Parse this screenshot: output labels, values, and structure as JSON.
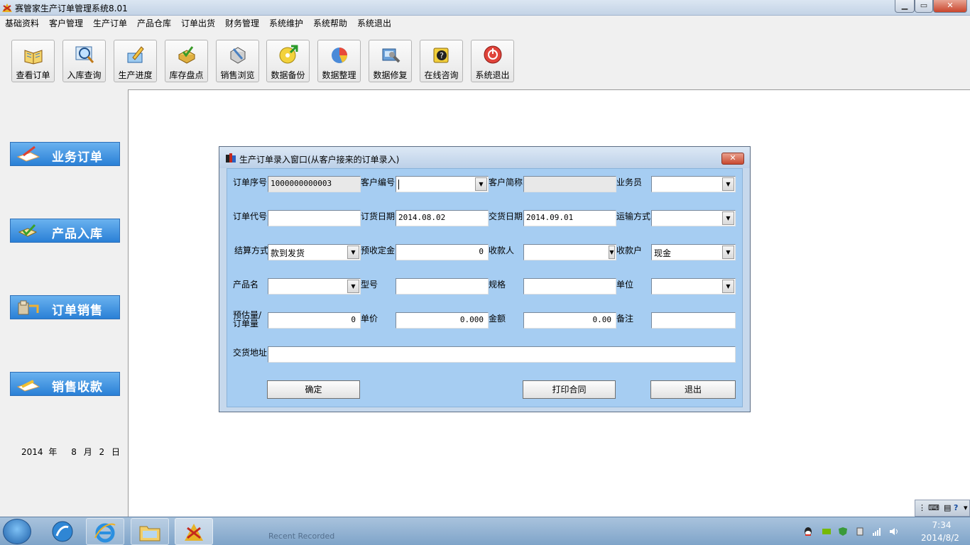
{
  "window": {
    "title": "赛管家生产订单管理系统8.01"
  },
  "menu": [
    "基础资料",
    "客户管理",
    "生产订单",
    "产品仓库",
    "订单出货",
    "财务管理",
    "系统维护",
    "系统帮助",
    "系统退出"
  ],
  "toolbar": [
    {
      "label": "查看订单",
      "icon": "book-icon"
    },
    {
      "label": "入库查询",
      "icon": "magnifier-icon"
    },
    {
      "label": "生产进度",
      "icon": "pen-notepad-icon"
    },
    {
      "label": "库存盘点",
      "icon": "box-check-icon"
    },
    {
      "label": "销售浏览",
      "icon": "tools-icon"
    },
    {
      "label": "数据备份",
      "icon": "disk-arrow-icon"
    },
    {
      "label": "数据整理",
      "icon": "pie-chart-icon"
    },
    {
      "label": "数据修复",
      "icon": "repair-icon"
    },
    {
      "label": "在线咨询",
      "icon": "question-icon"
    },
    {
      "label": "系统退出",
      "icon": "power-icon"
    }
  ],
  "sidebar": {
    "buttons": [
      {
        "label": "业务订单",
        "icon": "order-icon"
      },
      {
        "label": "产品入库",
        "icon": "warehouse-icon"
      },
      {
        "label": "订单销售",
        "icon": "forklift-icon"
      },
      {
        "label": "销售收款",
        "icon": "payment-icon"
      }
    ],
    "date": {
      "year": "2014",
      "year_unit": "年",
      "month": "8",
      "month_unit": "月",
      "day": "2",
      "day_unit": "日"
    }
  },
  "dialog": {
    "title": "生产订单录入窗口(从客户接来的订单录入)",
    "fields": {
      "order_no": {
        "label": "订单序号",
        "value": "1000000000003"
      },
      "customer_code": {
        "label": "客户编号",
        "value": ""
      },
      "customer_short": {
        "label": "客户简称",
        "value": ""
      },
      "salesperson": {
        "label": "业务员",
        "value": ""
      },
      "order_code": {
        "label": "订单代号",
        "value": ""
      },
      "order_date": {
        "label": "订货日期",
        "value": "2014.08.02"
      },
      "delivery_date": {
        "label": "交货日期",
        "value": "2014.09.01"
      },
      "shipping": {
        "label": "运输方式",
        "value": ""
      },
      "settlement": {
        "label": "结算方式",
        "value": "款到发货"
      },
      "deposit": {
        "label": "预收定金",
        "value": "0"
      },
      "payee": {
        "label": "收款人",
        "value": ""
      },
      "account": {
        "label": "收款户",
        "value": "现金"
      },
      "product": {
        "label": "产品名",
        "value": ""
      },
      "model": {
        "label": "型号",
        "value": ""
      },
      "spec": {
        "label": "规格",
        "value": ""
      },
      "unit": {
        "label": "单位",
        "value": ""
      },
      "qty": {
        "label_line1": "预估量/",
        "label_line2": "订单量",
        "value": "0"
      },
      "price": {
        "label": "单价",
        "value": "0.000"
      },
      "amount": {
        "label": "金额",
        "value": "0.00"
      },
      "remark": {
        "label": "备注",
        "value": ""
      },
      "address": {
        "label": "交货地址",
        "value": ""
      }
    },
    "buttons": {
      "confirm": "确定",
      "print": "打印合同",
      "exit": "退出"
    }
  },
  "taskbar": {
    "description": "Recent Recorded",
    "time": "7:34",
    "date": "2014/8/2"
  }
}
